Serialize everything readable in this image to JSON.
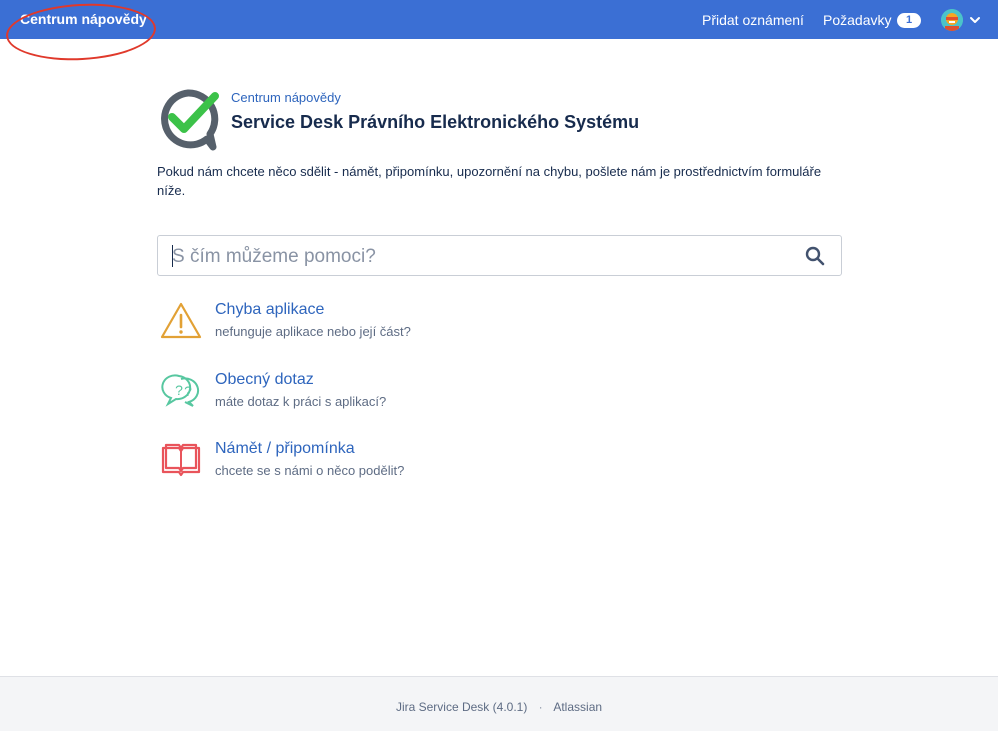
{
  "header": {
    "brand": "Centrum nápovědy",
    "announce_link": "Přidat oznámení",
    "requests_link": "Požadavky",
    "requests_count": "1",
    "avatar_icon": "user-avatar-icon",
    "menu_icon": "chevron-down-icon"
  },
  "portal": {
    "breadcrumb": "Centrum nápovědy",
    "title": "Service Desk Právního Elektronického Systému",
    "intro": "Pokud nám chcete něco sdělit - námět, připomínku, upozornění na chybu, pošlete nám je prostřednictvím formuláře níže."
  },
  "search": {
    "placeholder": "S čím můžeme pomoci?",
    "value": ""
  },
  "request_types": [
    {
      "title": "Chyba aplikace",
      "description": "nefunguje aplikace nebo její část?",
      "icon": "warning-icon"
    },
    {
      "title": "Obecný dotaz",
      "description": "máte dotaz k práci s aplikací?",
      "icon": "question-bubbles-icon"
    },
    {
      "title": "Námět / připomínka",
      "description": "chcete se s námi o něco podělit?",
      "icon": "open-book-icon"
    }
  ],
  "footer": {
    "product": "Jira Service Desk (4.0.1)",
    "separator": "·",
    "vendor": "Atlassian"
  },
  "colors": {
    "topbar": "#3b6fd4",
    "link": "#2e65bd",
    "annotation": "#e0392b",
    "warning": "#e2a135",
    "question": "#57c7a0",
    "book": "#e9545b"
  }
}
